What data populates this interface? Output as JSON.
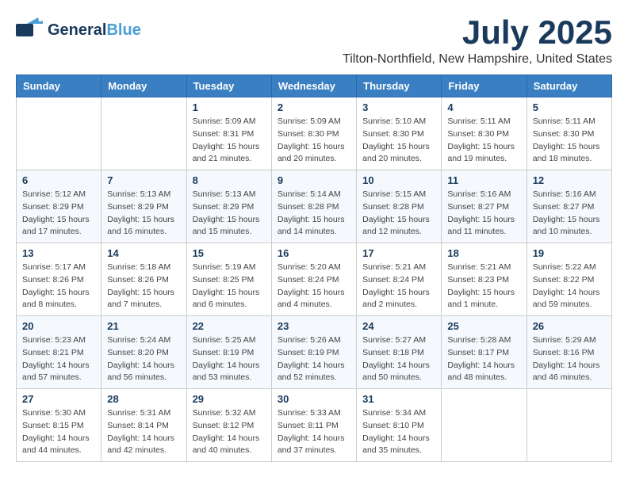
{
  "header": {
    "logo_general": "General",
    "logo_blue": "Blue",
    "month_title": "July 2025",
    "location": "Tilton-Northfield, New Hampshire, United States"
  },
  "days_of_week": [
    "Sunday",
    "Monday",
    "Tuesday",
    "Wednesday",
    "Thursday",
    "Friday",
    "Saturday"
  ],
  "weeks": [
    [
      {
        "day": "",
        "info": ""
      },
      {
        "day": "",
        "info": ""
      },
      {
        "day": "1",
        "info": "Sunrise: 5:09 AM\nSunset: 8:31 PM\nDaylight: 15 hours\nand 21 minutes."
      },
      {
        "day": "2",
        "info": "Sunrise: 5:09 AM\nSunset: 8:30 PM\nDaylight: 15 hours\nand 20 minutes."
      },
      {
        "day": "3",
        "info": "Sunrise: 5:10 AM\nSunset: 8:30 PM\nDaylight: 15 hours\nand 20 minutes."
      },
      {
        "day": "4",
        "info": "Sunrise: 5:11 AM\nSunset: 8:30 PM\nDaylight: 15 hours\nand 19 minutes."
      },
      {
        "day": "5",
        "info": "Sunrise: 5:11 AM\nSunset: 8:30 PM\nDaylight: 15 hours\nand 18 minutes."
      }
    ],
    [
      {
        "day": "6",
        "info": "Sunrise: 5:12 AM\nSunset: 8:29 PM\nDaylight: 15 hours\nand 17 minutes."
      },
      {
        "day": "7",
        "info": "Sunrise: 5:13 AM\nSunset: 8:29 PM\nDaylight: 15 hours\nand 16 minutes."
      },
      {
        "day": "8",
        "info": "Sunrise: 5:13 AM\nSunset: 8:29 PM\nDaylight: 15 hours\nand 15 minutes."
      },
      {
        "day": "9",
        "info": "Sunrise: 5:14 AM\nSunset: 8:28 PM\nDaylight: 15 hours\nand 14 minutes."
      },
      {
        "day": "10",
        "info": "Sunrise: 5:15 AM\nSunset: 8:28 PM\nDaylight: 15 hours\nand 12 minutes."
      },
      {
        "day": "11",
        "info": "Sunrise: 5:16 AM\nSunset: 8:27 PM\nDaylight: 15 hours\nand 11 minutes."
      },
      {
        "day": "12",
        "info": "Sunrise: 5:16 AM\nSunset: 8:27 PM\nDaylight: 15 hours\nand 10 minutes."
      }
    ],
    [
      {
        "day": "13",
        "info": "Sunrise: 5:17 AM\nSunset: 8:26 PM\nDaylight: 15 hours\nand 8 minutes."
      },
      {
        "day": "14",
        "info": "Sunrise: 5:18 AM\nSunset: 8:26 PM\nDaylight: 15 hours\nand 7 minutes."
      },
      {
        "day": "15",
        "info": "Sunrise: 5:19 AM\nSunset: 8:25 PM\nDaylight: 15 hours\nand 6 minutes."
      },
      {
        "day": "16",
        "info": "Sunrise: 5:20 AM\nSunset: 8:24 PM\nDaylight: 15 hours\nand 4 minutes."
      },
      {
        "day": "17",
        "info": "Sunrise: 5:21 AM\nSunset: 8:24 PM\nDaylight: 15 hours\nand 2 minutes."
      },
      {
        "day": "18",
        "info": "Sunrise: 5:21 AM\nSunset: 8:23 PM\nDaylight: 15 hours\nand 1 minute."
      },
      {
        "day": "19",
        "info": "Sunrise: 5:22 AM\nSunset: 8:22 PM\nDaylight: 14 hours\nand 59 minutes."
      }
    ],
    [
      {
        "day": "20",
        "info": "Sunrise: 5:23 AM\nSunset: 8:21 PM\nDaylight: 14 hours\nand 57 minutes."
      },
      {
        "day": "21",
        "info": "Sunrise: 5:24 AM\nSunset: 8:20 PM\nDaylight: 14 hours\nand 56 minutes."
      },
      {
        "day": "22",
        "info": "Sunrise: 5:25 AM\nSunset: 8:19 PM\nDaylight: 14 hours\nand 53 minutes."
      },
      {
        "day": "23",
        "info": "Sunrise: 5:26 AM\nSunset: 8:19 PM\nDaylight: 14 hours\nand 52 minutes."
      },
      {
        "day": "24",
        "info": "Sunrise: 5:27 AM\nSunset: 8:18 PM\nDaylight: 14 hours\nand 50 minutes."
      },
      {
        "day": "25",
        "info": "Sunrise: 5:28 AM\nSunset: 8:17 PM\nDaylight: 14 hours\nand 48 minutes."
      },
      {
        "day": "26",
        "info": "Sunrise: 5:29 AM\nSunset: 8:16 PM\nDaylight: 14 hours\nand 46 minutes."
      }
    ],
    [
      {
        "day": "27",
        "info": "Sunrise: 5:30 AM\nSunset: 8:15 PM\nDaylight: 14 hours\nand 44 minutes."
      },
      {
        "day": "28",
        "info": "Sunrise: 5:31 AM\nSunset: 8:14 PM\nDaylight: 14 hours\nand 42 minutes."
      },
      {
        "day": "29",
        "info": "Sunrise: 5:32 AM\nSunset: 8:12 PM\nDaylight: 14 hours\nand 40 minutes."
      },
      {
        "day": "30",
        "info": "Sunrise: 5:33 AM\nSunset: 8:11 PM\nDaylight: 14 hours\nand 37 minutes."
      },
      {
        "day": "31",
        "info": "Sunrise: 5:34 AM\nSunset: 8:10 PM\nDaylight: 14 hours\nand 35 minutes."
      },
      {
        "day": "",
        "info": ""
      },
      {
        "day": "",
        "info": ""
      }
    ]
  ]
}
